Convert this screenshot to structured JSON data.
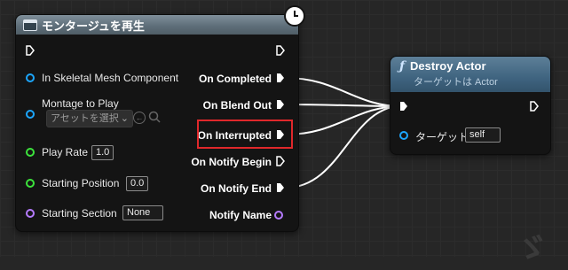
{
  "montage_node": {
    "title": "モンタージュを再生",
    "inputs": {
      "skeletal_mesh": "In Skeletal Mesh Component",
      "montage": "Montage to Play",
      "asset_select": "アセットを選択",
      "play_rate_label": "Play Rate",
      "play_rate_value": "1.0",
      "start_pos_label": "Starting Position",
      "start_pos_value": "0.0",
      "start_section_label": "Starting Section",
      "start_section_value": "None"
    },
    "outputs": {
      "completed": "On Completed",
      "blend_out": "On Blend Out",
      "interrupted": "On Interrupted",
      "notify_begin": "On Notify Begin",
      "notify_end": "On Notify End",
      "notify_name": "Notify Name"
    }
  },
  "destroy_node": {
    "title": "Destroy Actor",
    "subtitle": "ターゲットは Actor",
    "target_label": "ターゲット",
    "target_value": "self"
  },
  "colors": {
    "highlight": "#e0282b",
    "object_pin": "#1ca6ff",
    "float_pin": "#3ce33c",
    "name_pin": "#b57bff"
  },
  "watermark": "ゞ"
}
